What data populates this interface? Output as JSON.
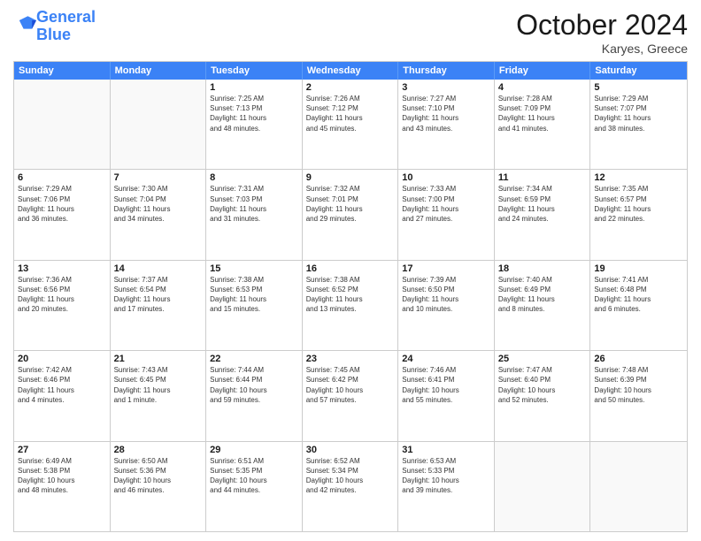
{
  "header": {
    "logo_line1": "General",
    "logo_line2": "Blue",
    "month_title": "October 2024",
    "location": "Karyes, Greece"
  },
  "weekdays": [
    "Sunday",
    "Monday",
    "Tuesday",
    "Wednesday",
    "Thursday",
    "Friday",
    "Saturday"
  ],
  "rows": [
    [
      {
        "day": "",
        "info": ""
      },
      {
        "day": "",
        "info": ""
      },
      {
        "day": "1",
        "info": "Sunrise: 7:25 AM\nSunset: 7:13 PM\nDaylight: 11 hours\nand 48 minutes."
      },
      {
        "day": "2",
        "info": "Sunrise: 7:26 AM\nSunset: 7:12 PM\nDaylight: 11 hours\nand 45 minutes."
      },
      {
        "day": "3",
        "info": "Sunrise: 7:27 AM\nSunset: 7:10 PM\nDaylight: 11 hours\nand 43 minutes."
      },
      {
        "day": "4",
        "info": "Sunrise: 7:28 AM\nSunset: 7:09 PM\nDaylight: 11 hours\nand 41 minutes."
      },
      {
        "day": "5",
        "info": "Sunrise: 7:29 AM\nSunset: 7:07 PM\nDaylight: 11 hours\nand 38 minutes."
      }
    ],
    [
      {
        "day": "6",
        "info": "Sunrise: 7:29 AM\nSunset: 7:06 PM\nDaylight: 11 hours\nand 36 minutes."
      },
      {
        "day": "7",
        "info": "Sunrise: 7:30 AM\nSunset: 7:04 PM\nDaylight: 11 hours\nand 34 minutes."
      },
      {
        "day": "8",
        "info": "Sunrise: 7:31 AM\nSunset: 7:03 PM\nDaylight: 11 hours\nand 31 minutes."
      },
      {
        "day": "9",
        "info": "Sunrise: 7:32 AM\nSunset: 7:01 PM\nDaylight: 11 hours\nand 29 minutes."
      },
      {
        "day": "10",
        "info": "Sunrise: 7:33 AM\nSunset: 7:00 PM\nDaylight: 11 hours\nand 27 minutes."
      },
      {
        "day": "11",
        "info": "Sunrise: 7:34 AM\nSunset: 6:59 PM\nDaylight: 11 hours\nand 24 minutes."
      },
      {
        "day": "12",
        "info": "Sunrise: 7:35 AM\nSunset: 6:57 PM\nDaylight: 11 hours\nand 22 minutes."
      }
    ],
    [
      {
        "day": "13",
        "info": "Sunrise: 7:36 AM\nSunset: 6:56 PM\nDaylight: 11 hours\nand 20 minutes."
      },
      {
        "day": "14",
        "info": "Sunrise: 7:37 AM\nSunset: 6:54 PM\nDaylight: 11 hours\nand 17 minutes."
      },
      {
        "day": "15",
        "info": "Sunrise: 7:38 AM\nSunset: 6:53 PM\nDaylight: 11 hours\nand 15 minutes."
      },
      {
        "day": "16",
        "info": "Sunrise: 7:38 AM\nSunset: 6:52 PM\nDaylight: 11 hours\nand 13 minutes."
      },
      {
        "day": "17",
        "info": "Sunrise: 7:39 AM\nSunset: 6:50 PM\nDaylight: 11 hours\nand 10 minutes."
      },
      {
        "day": "18",
        "info": "Sunrise: 7:40 AM\nSunset: 6:49 PM\nDaylight: 11 hours\nand 8 minutes."
      },
      {
        "day": "19",
        "info": "Sunrise: 7:41 AM\nSunset: 6:48 PM\nDaylight: 11 hours\nand 6 minutes."
      }
    ],
    [
      {
        "day": "20",
        "info": "Sunrise: 7:42 AM\nSunset: 6:46 PM\nDaylight: 11 hours\nand 4 minutes."
      },
      {
        "day": "21",
        "info": "Sunrise: 7:43 AM\nSunset: 6:45 PM\nDaylight: 11 hours\nand 1 minute."
      },
      {
        "day": "22",
        "info": "Sunrise: 7:44 AM\nSunset: 6:44 PM\nDaylight: 10 hours\nand 59 minutes."
      },
      {
        "day": "23",
        "info": "Sunrise: 7:45 AM\nSunset: 6:42 PM\nDaylight: 10 hours\nand 57 minutes."
      },
      {
        "day": "24",
        "info": "Sunrise: 7:46 AM\nSunset: 6:41 PM\nDaylight: 10 hours\nand 55 minutes."
      },
      {
        "day": "25",
        "info": "Sunrise: 7:47 AM\nSunset: 6:40 PM\nDaylight: 10 hours\nand 52 minutes."
      },
      {
        "day": "26",
        "info": "Sunrise: 7:48 AM\nSunset: 6:39 PM\nDaylight: 10 hours\nand 50 minutes."
      }
    ],
    [
      {
        "day": "27",
        "info": "Sunrise: 6:49 AM\nSunset: 5:38 PM\nDaylight: 10 hours\nand 48 minutes."
      },
      {
        "day": "28",
        "info": "Sunrise: 6:50 AM\nSunset: 5:36 PM\nDaylight: 10 hours\nand 46 minutes."
      },
      {
        "day": "29",
        "info": "Sunrise: 6:51 AM\nSunset: 5:35 PM\nDaylight: 10 hours\nand 44 minutes."
      },
      {
        "day": "30",
        "info": "Sunrise: 6:52 AM\nSunset: 5:34 PM\nDaylight: 10 hours\nand 42 minutes."
      },
      {
        "day": "31",
        "info": "Sunrise: 6:53 AM\nSunset: 5:33 PM\nDaylight: 10 hours\nand 39 minutes."
      },
      {
        "day": "",
        "info": ""
      },
      {
        "day": "",
        "info": ""
      }
    ]
  ]
}
